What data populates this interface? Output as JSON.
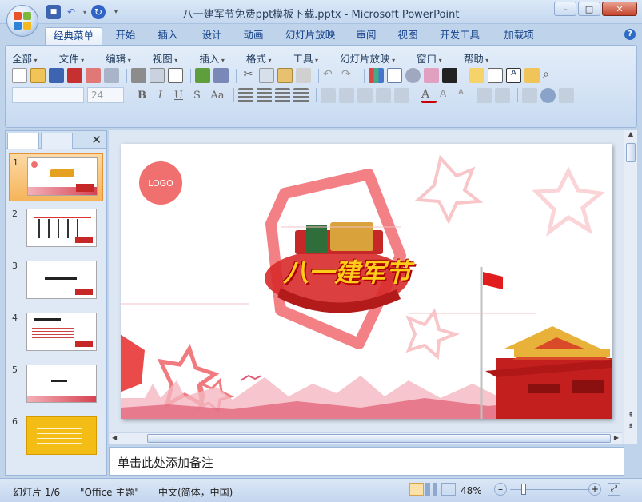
{
  "window": {
    "title": "八一建军节免费ppt模板下载.pptx - Microsoft PowerPoint",
    "min": "–",
    "max": "□",
    "close": "✕"
  },
  "ribbon_tabs": [
    "经典菜单",
    "开始",
    "插入",
    "设计",
    "动画",
    "幻灯片放映",
    "审阅",
    "视图",
    "开发工具",
    "加载项"
  ],
  "menu": [
    "全部",
    "文件",
    "编辑",
    "视图",
    "插入",
    "格式",
    "工具",
    "幻灯片放映",
    "窗口",
    "帮助"
  ],
  "font_size": "24",
  "format_buttons": [
    "B",
    "I",
    "U",
    "S",
    "Aa"
  ],
  "panel": {
    "close": "✕"
  },
  "thumbs": [
    {
      "num": "1"
    },
    {
      "num": "2"
    },
    {
      "num": "3"
    },
    {
      "num": "4"
    },
    {
      "num": "5"
    },
    {
      "num": "6"
    }
  ],
  "slide": {
    "logo": "LOGO",
    "banner": "八一建军节"
  },
  "notes": {
    "placeholder": "单击此处添加备注"
  },
  "status": {
    "slide_pos": "幻灯片 1/6",
    "theme": "\"Office 主题\"",
    "language": "中文(简体，中国)",
    "zoom": "48%"
  },
  "colors": {
    "accent_red": "#e8323c",
    "ribbon_blue": "#15428b",
    "selection_orange": "#f6b45a"
  }
}
